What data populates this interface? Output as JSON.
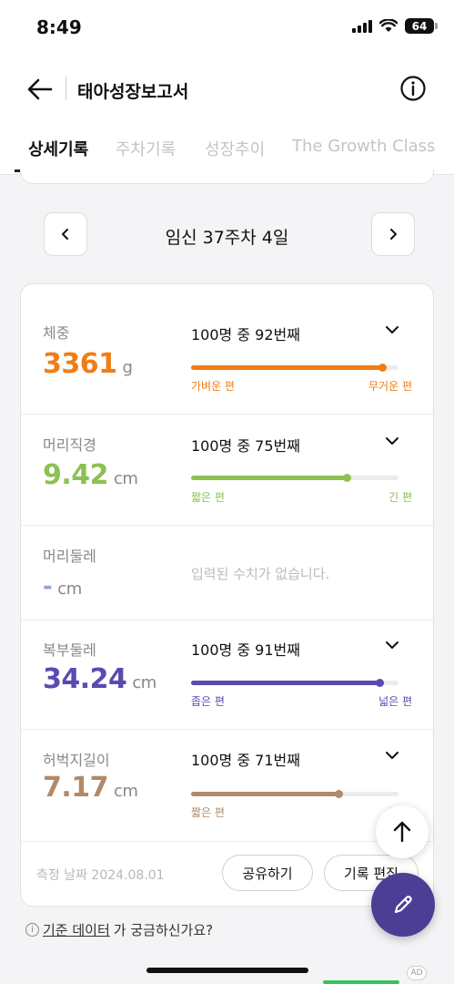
{
  "status_bar": {
    "time": "8:49",
    "battery": "64"
  },
  "header": {
    "title": "태아성장보고서"
  },
  "tabs": [
    {
      "label": "상세기록",
      "active": true
    },
    {
      "label": "주차기록",
      "active": false
    },
    {
      "label": "성장추이",
      "active": false
    },
    {
      "label": "The Growth Class",
      "active": false
    }
  ],
  "week_nav": {
    "label": "임신 37주차 4일"
  },
  "measurements": [
    {
      "label": "체중",
      "value": "3361",
      "unit": "g",
      "rank": "100명 중 92번째",
      "percent": 0.92,
      "low_label": "가벼운 편",
      "high_label": "무거운 편",
      "color": "#f07d16"
    },
    {
      "label": "머리직경",
      "value": "9.42",
      "unit": "cm",
      "rank": "100명 중 75번째",
      "percent": 0.75,
      "low_label": "짧은 편",
      "high_label": "긴 편",
      "color": "#8cc152"
    },
    {
      "label": "머리둘레",
      "value": "-",
      "unit": "cm",
      "empty_text": "입력된 수치가 없습니다.",
      "color": "#8fa5d6"
    },
    {
      "label": "복부둘레",
      "value": "34.24",
      "unit": "cm",
      "rank": "100명 중 91번째",
      "percent": 0.91,
      "low_label": "좁은 편",
      "high_label": "넓은 편",
      "color": "#5a4bb0"
    },
    {
      "label": "허벅지길이",
      "value": "7.17",
      "unit": "cm",
      "rank": "100명 중 71번째",
      "percent": 0.71,
      "low_label": "짧은 편",
      "high_label": "긴 편",
      "color": "#b08a6a"
    }
  ],
  "footer": {
    "measure_date": "측정 날짜 2024.08.01",
    "share_label": "공유하기",
    "edit_label": "기록 편집"
  },
  "footnote": {
    "link": "기준 데이터",
    "rest": "가 궁금하신가요?"
  },
  "ad_label": "AD"
}
